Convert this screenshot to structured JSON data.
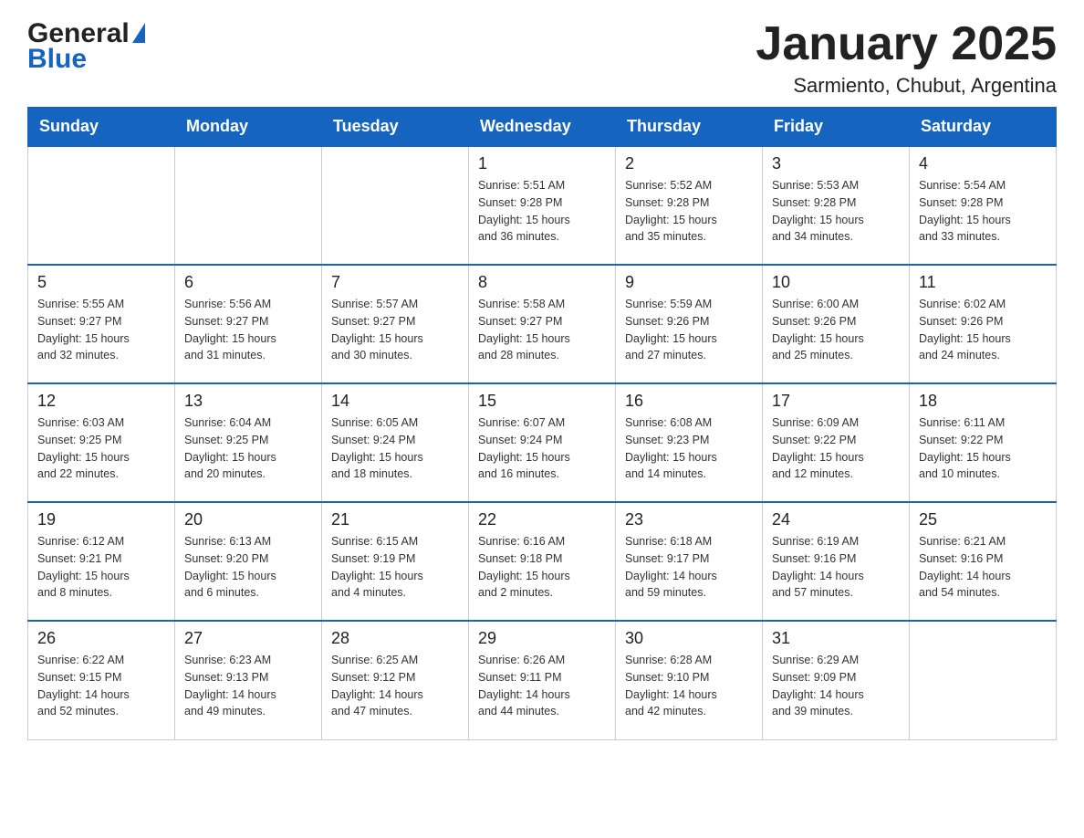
{
  "header": {
    "title": "January 2025",
    "subtitle": "Sarmiento, Chubut, Argentina"
  },
  "logo": {
    "general": "General",
    "blue": "Blue"
  },
  "weekdays": [
    "Sunday",
    "Monday",
    "Tuesday",
    "Wednesday",
    "Thursday",
    "Friday",
    "Saturday"
  ],
  "weeks": [
    [
      {
        "day": "",
        "info": ""
      },
      {
        "day": "",
        "info": ""
      },
      {
        "day": "",
        "info": ""
      },
      {
        "day": "1",
        "info": "Sunrise: 5:51 AM\nSunset: 9:28 PM\nDaylight: 15 hours\nand 36 minutes."
      },
      {
        "day": "2",
        "info": "Sunrise: 5:52 AM\nSunset: 9:28 PM\nDaylight: 15 hours\nand 35 minutes."
      },
      {
        "day": "3",
        "info": "Sunrise: 5:53 AM\nSunset: 9:28 PM\nDaylight: 15 hours\nand 34 minutes."
      },
      {
        "day": "4",
        "info": "Sunrise: 5:54 AM\nSunset: 9:28 PM\nDaylight: 15 hours\nand 33 minutes."
      }
    ],
    [
      {
        "day": "5",
        "info": "Sunrise: 5:55 AM\nSunset: 9:27 PM\nDaylight: 15 hours\nand 32 minutes."
      },
      {
        "day": "6",
        "info": "Sunrise: 5:56 AM\nSunset: 9:27 PM\nDaylight: 15 hours\nand 31 minutes."
      },
      {
        "day": "7",
        "info": "Sunrise: 5:57 AM\nSunset: 9:27 PM\nDaylight: 15 hours\nand 30 minutes."
      },
      {
        "day": "8",
        "info": "Sunrise: 5:58 AM\nSunset: 9:27 PM\nDaylight: 15 hours\nand 28 minutes."
      },
      {
        "day": "9",
        "info": "Sunrise: 5:59 AM\nSunset: 9:26 PM\nDaylight: 15 hours\nand 27 minutes."
      },
      {
        "day": "10",
        "info": "Sunrise: 6:00 AM\nSunset: 9:26 PM\nDaylight: 15 hours\nand 25 minutes."
      },
      {
        "day": "11",
        "info": "Sunrise: 6:02 AM\nSunset: 9:26 PM\nDaylight: 15 hours\nand 24 minutes."
      }
    ],
    [
      {
        "day": "12",
        "info": "Sunrise: 6:03 AM\nSunset: 9:25 PM\nDaylight: 15 hours\nand 22 minutes."
      },
      {
        "day": "13",
        "info": "Sunrise: 6:04 AM\nSunset: 9:25 PM\nDaylight: 15 hours\nand 20 minutes."
      },
      {
        "day": "14",
        "info": "Sunrise: 6:05 AM\nSunset: 9:24 PM\nDaylight: 15 hours\nand 18 minutes."
      },
      {
        "day": "15",
        "info": "Sunrise: 6:07 AM\nSunset: 9:24 PM\nDaylight: 15 hours\nand 16 minutes."
      },
      {
        "day": "16",
        "info": "Sunrise: 6:08 AM\nSunset: 9:23 PM\nDaylight: 15 hours\nand 14 minutes."
      },
      {
        "day": "17",
        "info": "Sunrise: 6:09 AM\nSunset: 9:22 PM\nDaylight: 15 hours\nand 12 minutes."
      },
      {
        "day": "18",
        "info": "Sunrise: 6:11 AM\nSunset: 9:22 PM\nDaylight: 15 hours\nand 10 minutes."
      }
    ],
    [
      {
        "day": "19",
        "info": "Sunrise: 6:12 AM\nSunset: 9:21 PM\nDaylight: 15 hours\nand 8 minutes."
      },
      {
        "day": "20",
        "info": "Sunrise: 6:13 AM\nSunset: 9:20 PM\nDaylight: 15 hours\nand 6 minutes."
      },
      {
        "day": "21",
        "info": "Sunrise: 6:15 AM\nSunset: 9:19 PM\nDaylight: 15 hours\nand 4 minutes."
      },
      {
        "day": "22",
        "info": "Sunrise: 6:16 AM\nSunset: 9:18 PM\nDaylight: 15 hours\nand 2 minutes."
      },
      {
        "day": "23",
        "info": "Sunrise: 6:18 AM\nSunset: 9:17 PM\nDaylight: 14 hours\nand 59 minutes."
      },
      {
        "day": "24",
        "info": "Sunrise: 6:19 AM\nSunset: 9:16 PM\nDaylight: 14 hours\nand 57 minutes."
      },
      {
        "day": "25",
        "info": "Sunrise: 6:21 AM\nSunset: 9:16 PM\nDaylight: 14 hours\nand 54 minutes."
      }
    ],
    [
      {
        "day": "26",
        "info": "Sunrise: 6:22 AM\nSunset: 9:15 PM\nDaylight: 14 hours\nand 52 minutes."
      },
      {
        "day": "27",
        "info": "Sunrise: 6:23 AM\nSunset: 9:13 PM\nDaylight: 14 hours\nand 49 minutes."
      },
      {
        "day": "28",
        "info": "Sunrise: 6:25 AM\nSunset: 9:12 PM\nDaylight: 14 hours\nand 47 minutes."
      },
      {
        "day": "29",
        "info": "Sunrise: 6:26 AM\nSunset: 9:11 PM\nDaylight: 14 hours\nand 44 minutes."
      },
      {
        "day": "30",
        "info": "Sunrise: 6:28 AM\nSunset: 9:10 PM\nDaylight: 14 hours\nand 42 minutes."
      },
      {
        "day": "31",
        "info": "Sunrise: 6:29 AM\nSunset: 9:09 PM\nDaylight: 14 hours\nand 39 minutes."
      },
      {
        "day": "",
        "info": ""
      }
    ]
  ]
}
